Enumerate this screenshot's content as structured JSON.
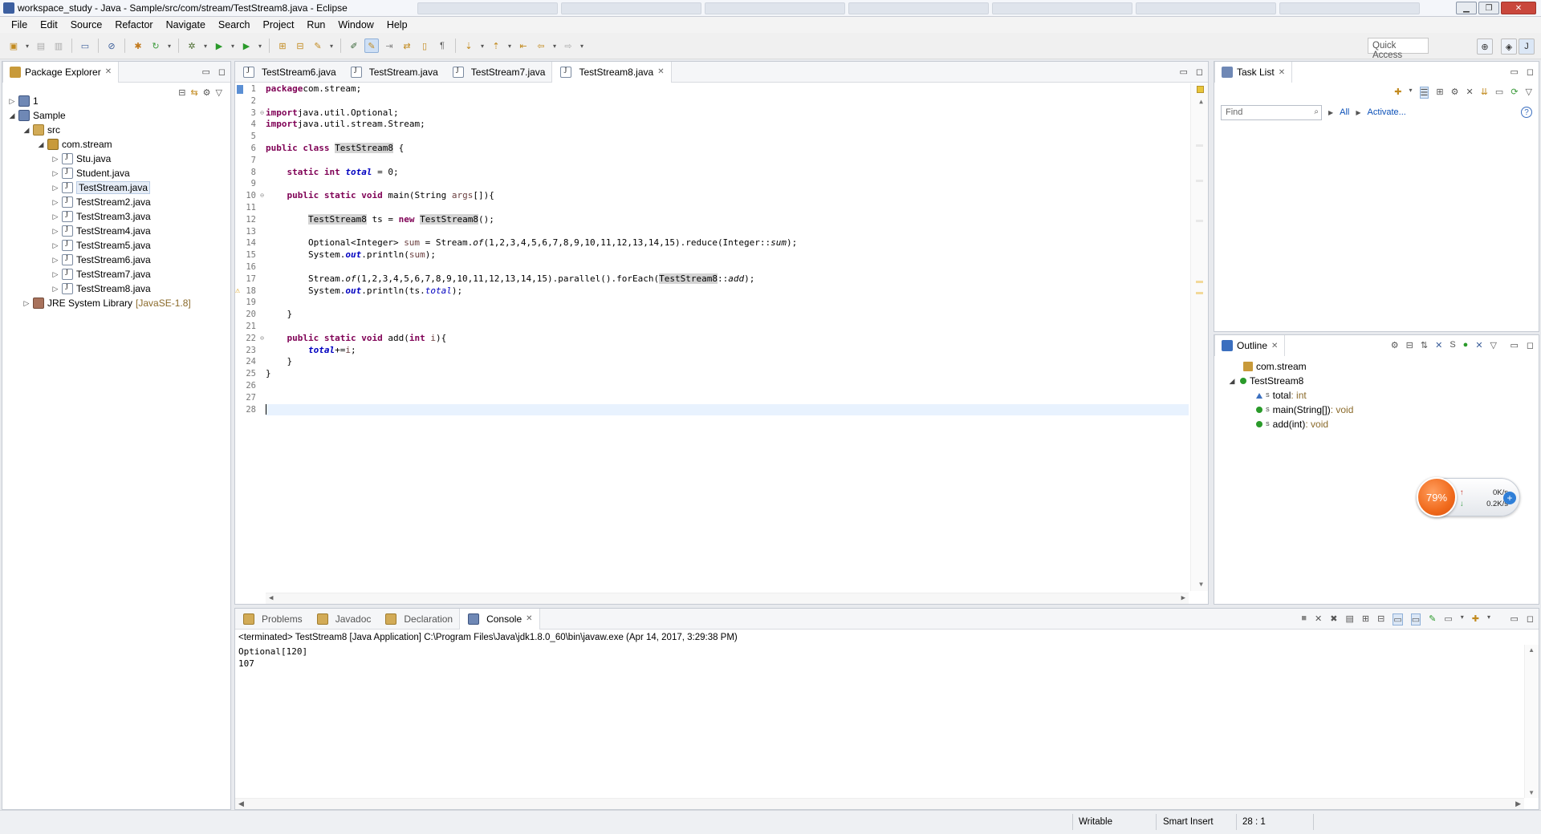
{
  "window": {
    "title": "workspace_study - Java - Sample/src/com/stream/TestStream8.java - Eclipse"
  },
  "menu": [
    "File",
    "Edit",
    "Source",
    "Refactor",
    "Navigate",
    "Search",
    "Project",
    "Run",
    "Window",
    "Help"
  ],
  "quick_access": "Quick Access",
  "package_explorer": {
    "tab": "Package Explorer",
    "tree": [
      {
        "label": "1",
        "level": 0,
        "twisty": "▷",
        "icon": "proj"
      },
      {
        "label": "Sample",
        "level": 0,
        "twisty": "◢",
        "icon": "proj"
      },
      {
        "label": "src",
        "level": 1,
        "twisty": "◢",
        "icon": "src"
      },
      {
        "label": "com.stream",
        "level": 2,
        "twisty": "◢",
        "icon": "pkg"
      },
      {
        "label": "Stu.java",
        "level": 3,
        "twisty": "▷",
        "icon": "java"
      },
      {
        "label": "Student.java",
        "level": 3,
        "twisty": "▷",
        "icon": "java"
      },
      {
        "label": "TestStream.java",
        "level": 3,
        "twisty": "▷",
        "icon": "java",
        "selected": true
      },
      {
        "label": "TestStream2.java",
        "level": 3,
        "twisty": "▷",
        "icon": "java"
      },
      {
        "label": "TestStream3.java",
        "level": 3,
        "twisty": "▷",
        "icon": "java"
      },
      {
        "label": "TestStream4.java",
        "level": 3,
        "twisty": "▷",
        "icon": "java"
      },
      {
        "label": "TestStream5.java",
        "level": 3,
        "twisty": "▷",
        "icon": "java"
      },
      {
        "label": "TestStream6.java",
        "level": 3,
        "twisty": "▷",
        "icon": "java"
      },
      {
        "label": "TestStream7.java",
        "level": 3,
        "twisty": "▷",
        "icon": "java"
      },
      {
        "label": "TestStream8.java",
        "level": 3,
        "twisty": "▷",
        "icon": "java"
      },
      {
        "label": "JRE System Library",
        "level": 1,
        "twisty": "▷",
        "icon": "lib",
        "decor": "[JavaSE-1.8]"
      }
    ]
  },
  "editor": {
    "tabs": [
      {
        "label": "TestStream6.java",
        "active": false
      },
      {
        "label": "TestStream.java",
        "active": false
      },
      {
        "label": "TestStream7.java",
        "active": false
      },
      {
        "label": "TestStream8.java",
        "active": true
      }
    ],
    "line_count": 28,
    "lines": [
      [
        [
          "kw",
          "package"
        ],
        [
          "",
          "com.stream;"
        ]
      ],
      [],
      [
        [
          "kw",
          "import"
        ],
        [
          "",
          "java.util.Optional;"
        ]
      ],
      [
        [
          "kw",
          "import"
        ],
        [
          "",
          "java.util.stream.Stream;"
        ]
      ],
      [],
      [
        [
          "kw",
          "public class "
        ],
        [
          "hl",
          "TestStream8"
        ],
        [
          "",
          " {"
        ]
      ],
      [],
      [
        [
          "",
          "    "
        ],
        [
          "kw",
          "static int "
        ],
        [
          "sfld",
          "total"
        ],
        [
          "",
          " = 0;"
        ]
      ],
      [],
      [
        [
          "",
          "    "
        ],
        [
          "kw",
          "public static void "
        ],
        [
          "",
          "main(String "
        ],
        [
          "param",
          "args"
        ],
        [
          "",
          "[]){"
        ]
      ],
      [],
      [
        [
          "",
          "        "
        ],
        [
          "hl",
          "TestStream8"
        ],
        [
          "",
          " ts = "
        ],
        [
          "kw",
          "new "
        ],
        [
          "hl",
          "TestStream8"
        ],
        [
          "",
          "();"
        ]
      ],
      [],
      [
        [
          "",
          "        Optional<Integer> "
        ],
        [
          "param",
          "sum"
        ],
        [
          "",
          " = Stream."
        ],
        [
          "ital",
          "of"
        ],
        [
          "",
          "(1,2,3,4,5,6,7,8,9,10,11,12,13,14,15).reduce(Integer::"
        ],
        [
          "ital",
          "sum"
        ],
        [
          "",
          ");"
        ]
      ],
      [
        [
          "",
          "        System."
        ],
        [
          "sfld",
          "out"
        ],
        [
          "",
          ".println("
        ],
        [
          "param",
          "sum"
        ],
        [
          "",
          ");"
        ]
      ],
      [],
      [
        [
          "",
          "        Stream."
        ],
        [
          "ital",
          "of"
        ],
        [
          "",
          "(1,2,3,4,5,6,7,8,9,10,11,12,13,14,15).parallel().forEach("
        ],
        [
          "hl",
          "TestStream8"
        ],
        [
          "",
          "::"
        ],
        [
          "ital",
          "add"
        ],
        [
          "",
          ");"
        ]
      ],
      [
        [
          "",
          "        System."
        ],
        [
          "sfld",
          "out"
        ],
        [
          "",
          ".println(ts."
        ],
        [
          "fld",
          "total"
        ],
        [
          "",
          ");"
        ]
      ],
      [],
      [
        [
          "",
          "    }"
        ]
      ],
      [],
      [
        [
          "",
          "    "
        ],
        [
          "kw",
          "public static void "
        ],
        [
          "",
          "add("
        ],
        [
          "kw",
          "int "
        ],
        [
          "param",
          "i"
        ],
        [
          "",
          "){"
        ]
      ],
      [
        [
          "",
          "        "
        ],
        [
          "sfld",
          "total"
        ],
        [
          "",
          "+="
        ],
        [
          "param",
          "i"
        ],
        [
          "",
          ";"
        ]
      ],
      [
        [
          "",
          "    }"
        ]
      ],
      [
        [
          "",
          "}"
        ]
      ],
      [],
      [],
      [
        [
          "caret",
          ""
        ]
      ]
    ]
  },
  "task_list": {
    "tab": "Task List",
    "find_placeholder": "Find",
    "all": "All",
    "activate": "Activate..."
  },
  "outline": {
    "tab": "Outline",
    "items": [
      {
        "label": "com.stream",
        "type": "",
        "kind": "pkg",
        "level": 0
      },
      {
        "label": "TestStream8",
        "type": "",
        "kind": "class",
        "level": 0
      },
      {
        "label": "total",
        "type": " : int",
        "kind": "field",
        "level": 1
      },
      {
        "label": "main(String[])",
        "type": " : void",
        "kind": "method",
        "level": 1
      },
      {
        "label": "add(int)",
        "type": " : void",
        "kind": "method",
        "level": 1
      }
    ]
  },
  "net_widget": {
    "percent": "79%",
    "up": "0K/s",
    "down": "0.2K/s"
  },
  "bottom_tabs": [
    {
      "label": "Problems",
      "active": false
    },
    {
      "label": "Javadoc",
      "active": false
    },
    {
      "label": "Declaration",
      "active": false
    },
    {
      "label": "Console",
      "active": true
    }
  ],
  "console": {
    "status": "<terminated> TestStream8 [Java Application] C:\\Program Files\\Java\\jdk1.8.0_60\\bin\\javaw.exe (Apr 14, 2017, 3:29:38 PM)",
    "output": [
      "Optional[120]",
      "107"
    ]
  },
  "statusbar": {
    "writable": "Writable",
    "insert_mode": "Smart Insert",
    "position": "28 : 1"
  },
  "colors": {
    "keyword": "#7f0055",
    "field": "#0000c0",
    "current_line": "#e8f2fe",
    "selection_border": "#b9cbe3"
  }
}
